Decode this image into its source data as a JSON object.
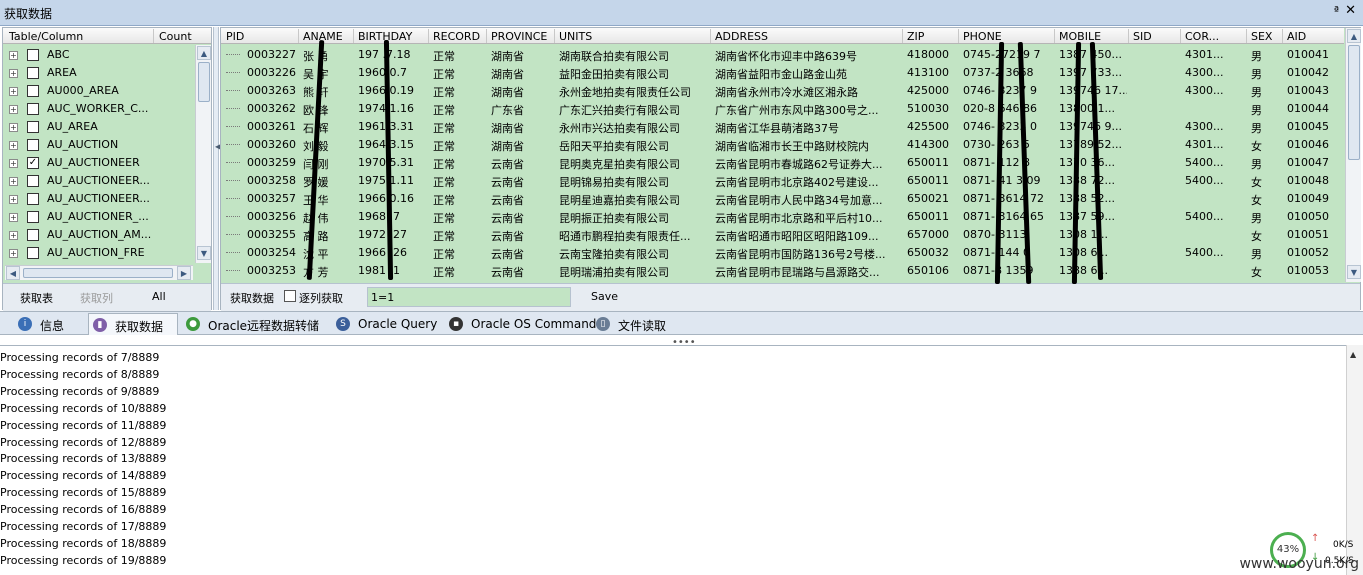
{
  "window": {
    "title": "获取数据",
    "pin_glyph": "ª",
    "close_glyph": "✕"
  },
  "table_panel": {
    "col_table": "Table/Column",
    "col_count": "Count",
    "items": [
      {
        "name": "ABC",
        "checked": false
      },
      {
        "name": "AREA",
        "checked": false
      },
      {
        "name": "AU000_AREA",
        "checked": false
      },
      {
        "name": "AUC_WORKER_C...",
        "checked": false
      },
      {
        "name": "AU_AREA",
        "checked": false
      },
      {
        "name": "AU_AUCTION",
        "checked": false
      },
      {
        "name": "AU_AUCTIONEER",
        "checked": true
      },
      {
        "name": "AU_AUCTIONEER...",
        "checked": false
      },
      {
        "name": "AU_AUCTIONEER...",
        "checked": false
      },
      {
        "name": "AU_AUCTIONER_...",
        "checked": false
      },
      {
        "name": "AU_AUCTION_AM...",
        "checked": false
      },
      {
        "name": "AU_AUCTION_FRE",
        "checked": false
      }
    ],
    "buttons": {
      "fetch_table": "获取表",
      "fetch_col": "获取列",
      "all": "All"
    }
  },
  "grid": {
    "columns": [
      "PID",
      "ANAME",
      "BIRTHDAY",
      "RECORD",
      "PROVINCE",
      "UNITS",
      "ADDRESS",
      "ZIP",
      "PHONE",
      "MOBILE",
      "SID",
      "COR...",
      "SEX",
      "AID"
    ],
    "rows": [
      [
        "0003227",
        "张 勇",
        "197 .7.18",
        "正常",
        "湖南省",
        "湖南联合拍卖有限公司",
        "湖南省怀化市迎丰中路639号",
        "418000",
        "0745-27219 7",
        "1387 450...",
        "",
        "4301...",
        "男",
        "010041"
      ],
      [
        "0003226",
        "吴 宇",
        "1960 0.7",
        "正常",
        "湖南省",
        "益阳金田拍卖有限公司",
        "湖南省益阳市金山路金山苑",
        "413100",
        "0737-2 3668",
        "1397 733...",
        "",
        "4300...",
        "男",
        "010042"
      ],
      [
        "0003263",
        "熊 轩",
        "1966 0.19",
        "正常",
        "湖南省",
        "永州金地拍卖有限责任公司",
        "湖南省永州市冷水滩区湘永路",
        "425000",
        "0746- 3237 9",
        "139746 17...",
        "",
        "4300...",
        "男",
        "010043"
      ],
      [
        "0003262",
        "欧 锋",
        "1974 1.16",
        "正常",
        "广东省",
        "广东汇兴拍卖行有限公司",
        "广东省广州市东风中路300号之...",
        "510030",
        "020-8 646 86",
        "13800 1...",
        "",
        "",
        "男",
        "010044"
      ],
      [
        "0003261",
        "石 辉",
        "1961 3.31",
        "正常",
        "湖南省",
        "永州市兴达拍卖有限公司",
        "湖南省江华县萌渚路37号",
        "425500",
        "0746- 3233 0",
        "139746 9...",
        "",
        "4300...",
        "男",
        "010045"
      ],
      [
        "0003260",
        "刘 毅",
        "1964 3.15",
        "正常",
        "湖南省",
        "岳阳天平拍卖有限公司",
        "湖南省临湘市长王中路财校院内",
        "414300",
        "0730- 263 5",
        "13789 52...",
        "",
        "4301...",
        "女",
        "010046"
      ],
      [
        "0003259",
        "闫 刚",
        "1970 5.31",
        "正常",
        "云南省",
        "昆明奥克星拍卖有限公司",
        "云南省昆明市春城路62号证券大...",
        "650011",
        "0871- 112 8",
        "1370 36...",
        "",
        "5400...",
        "男",
        "010047"
      ],
      [
        "0003258",
        "罗 媛",
        "1975 1.11",
        "正常",
        "云南省",
        "昆明锦易拍卖有限公司",
        "云南省昆明市北京路402号建设...",
        "650011",
        "0871- 41 3 09",
        "1388 72...",
        "",
        "5400...",
        "女",
        "010048"
      ],
      [
        "0003257",
        "王 华",
        "1966 0.16",
        "正常",
        "云南省",
        "昆明星迪嘉拍卖有限公司",
        "云南省昆明市人民中路34号加意...",
        "650021",
        "0871- 3614 72",
        "1388 52...",
        "",
        "",
        "女",
        "010049"
      ],
      [
        "0003256",
        "赵 伟",
        "1968 .7",
        "正常",
        "云南省",
        "昆明振正拍卖有限公司",
        "云南省昆明市北京路和平后村10...",
        "650011",
        "0871- 3164 65",
        "1387 59...",
        "",
        "5400...",
        "男",
        "010050"
      ],
      [
        "0003255",
        "高 路",
        "1972 .27",
        "正常",
        "云南省",
        "昭通市鹏程拍卖有限责任...",
        "云南省昭通市昭阳区昭阳路109...",
        "657000",
        "0870- 3113",
        "1308 1...",
        "",
        "",
        "女",
        "010051"
      ],
      [
        "0003254",
        "沈 平",
        "1966 .26",
        "正常",
        "云南省",
        "云南宝隆拍卖有限公司",
        "云南省昆明市国防路136号2号楼...",
        "650032",
        "0871- 144 0",
        "1308 6...",
        "",
        "5400...",
        "男",
        "010052"
      ],
      [
        "0003253",
        "方 芳",
        "1981 .1",
        "正常",
        "云南省",
        "昆明瑞浦拍卖有限公司",
        "云南省昆明市昆瑞路与昌源路交...",
        "650106",
        "0871-8 1359",
        "1388 6...",
        "",
        "",
        "女",
        "010053"
      ]
    ],
    "bottom": {
      "fetch_label": "获取数据",
      "per_col_label": "逐列获取",
      "per_col_checked": false,
      "where_value": "1=1",
      "save": "Save"
    }
  },
  "tabs": [
    {
      "label": "信息",
      "icon": "info-icon",
      "color": "#3b6fb6"
    },
    {
      "label": "获取数据",
      "icon": "database-icon",
      "color": "#7f5fa8",
      "active": true
    },
    {
      "label": "Oracle远程数据转储",
      "icon": "globe-icon",
      "color": "#3c9a3c"
    },
    {
      "label": "Oracle Query",
      "icon": "sql-icon",
      "color": "#3b5f9a"
    },
    {
      "label": "Oracle OS Command",
      "icon": "terminal-icon",
      "color": "#333333"
    },
    {
      "label": "文件读取",
      "icon": "file-icon",
      "color": "#6a7d95"
    }
  ],
  "log": {
    "lines": [
      "Processing records of 7/8889",
      "Processing records of 8/8889",
      "Processing records of 9/8889",
      "Processing records of 10/8889",
      "Processing records of 11/8889",
      "Processing records of 12/8889",
      "Processing records of 13/8889",
      "Processing records of 14/8889",
      "Processing records of 15/8889",
      "Processing records of 16/8889",
      "Processing records of 17/8889",
      "Processing records of 18/8889",
      "Processing records of 19/8889"
    ]
  },
  "net_widget": {
    "percent": "43%",
    "up": "0K/S",
    "down": "0.5K/S"
  },
  "watermark": "www.wooyun.org"
}
